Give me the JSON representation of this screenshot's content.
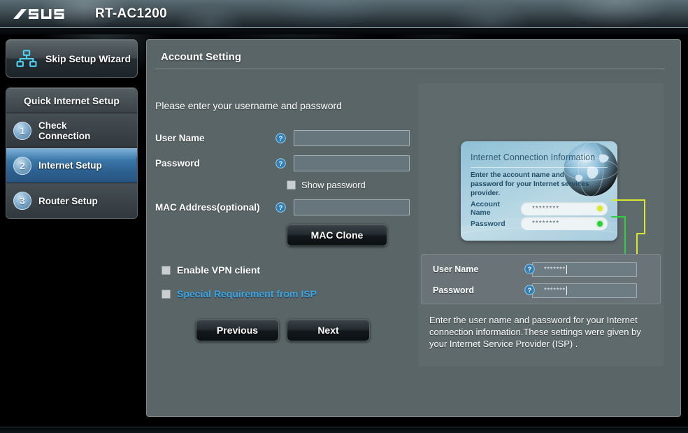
{
  "header": {
    "brand": "ASUS",
    "model": "RT-AC1200",
    "logo_icon": "asus-wordmark-logo"
  },
  "sidebar": {
    "skip_wizard": {
      "label": "Skip Setup Wizard",
      "icon": "network-topology-icon"
    },
    "section_title": "Quick Internet Setup",
    "steps": [
      {
        "number": "1",
        "label": "Check\nConnection",
        "active": false
      },
      {
        "number": "2",
        "label": "Internet Setup",
        "active": true
      },
      {
        "number": "3",
        "label": "Router Setup",
        "active": false
      }
    ]
  },
  "main": {
    "panel_title": "Account Setting",
    "intro_text": "Please enter your username and password",
    "fields": [
      {
        "label": "User Name",
        "value": "",
        "placeholder": "",
        "help_icon": "help-question-icon"
      },
      {
        "label": "Password",
        "value": "",
        "placeholder": "",
        "help_icon": "help-question-icon"
      },
      {
        "label": "MAC Address(optional)",
        "value": "",
        "placeholder": "",
        "help_icon": "help-question-icon"
      }
    ],
    "show_password": {
      "label": "Show password",
      "checked": false
    },
    "mac_clone_button": "MAC Clone",
    "options": [
      {
        "label": "Enable VPN client",
        "checked": false,
        "is_link": false
      },
      {
        "label": "Special Requirement from ISP",
        "checked": false,
        "is_link": true
      }
    ],
    "buttons": {
      "previous": "Previous",
      "next": "Next"
    }
  },
  "help_panel": {
    "illustration": {
      "title": "Internet Connection Information",
      "description": "Enter the account name and password for your Internet services provider.",
      "globe_icon": "globe-earth-icon",
      "rows": [
        {
          "label": "Account Name",
          "value": "********",
          "dot_color": "#d8e832"
        },
        {
          "label": "Password",
          "value": "********",
          "dot_color": "#2fd13a"
        }
      ]
    },
    "credentials": [
      {
        "label": "User Name",
        "value": "*******",
        "help_icon": "help-question-icon"
      },
      {
        "label": "Password",
        "value": "*******",
        "help_icon": "help-question-icon"
      }
    ],
    "description": "Enter the user name and password for your Internet connection information.These settings were given by your Internet Service Provider (ISP) ."
  },
  "colors": {
    "accent_blue": "#3aa7e8",
    "panel_bg": "#5a6568",
    "active_step_blue": "#2c5f8e",
    "connector_yellow": "#d8e832",
    "connector_green": "#2fd13a"
  }
}
